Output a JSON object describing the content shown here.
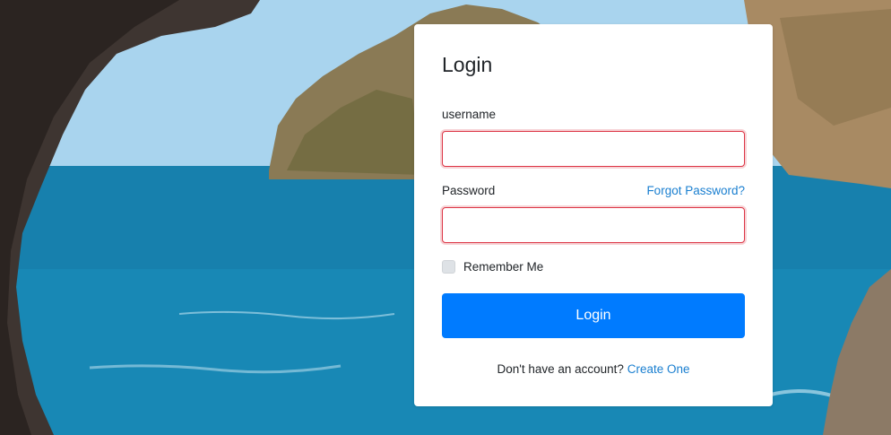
{
  "form": {
    "title": "Login",
    "username_label": "username",
    "username_value": "",
    "password_label": "Password",
    "password_value": "",
    "forgot_password_link": "Forgot Password?",
    "remember_me_label": "Remember Me",
    "remember_me_checked": false,
    "login_button": "Login",
    "signup_prompt": "Don't have an account?",
    "signup_link": "Create One"
  },
  "colors": {
    "primary": "#007bff",
    "link": "#1a7fd0",
    "error_border": "#dc3545"
  },
  "background": {
    "description_icon": "coastal-landscape-photo"
  }
}
